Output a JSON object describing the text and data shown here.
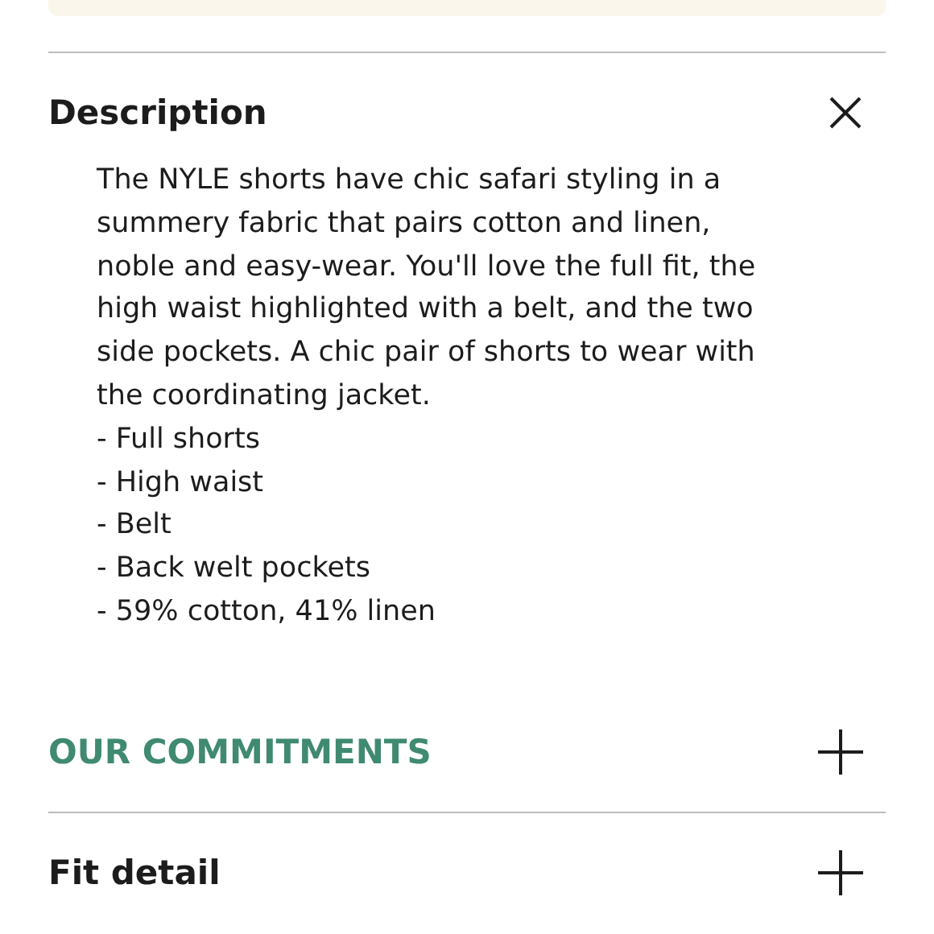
{
  "sections": [
    {
      "title": "Description",
      "expanded": true,
      "color": "#1c1c1c",
      "body": "The NYLE shorts have chic safari styling in a summery fabric that pairs cotton and linen, noble and easy-wear. You'll love the full fit, the high waist highlighted with a belt, and the two side pockets. A chic pair of shorts to wear with the coordinating jacket.",
      "bullets": [
        "- Full shorts",
        "- High waist",
        "- Belt",
        "- Back welt pockets",
        "- 59% cotton, 41% linen"
      ]
    },
    {
      "title": "OUR COMMITMENTS",
      "expanded": false,
      "color": "#3f8a70"
    },
    {
      "title": "Fit detail",
      "expanded": false,
      "color": "#1c1c1c"
    }
  ]
}
